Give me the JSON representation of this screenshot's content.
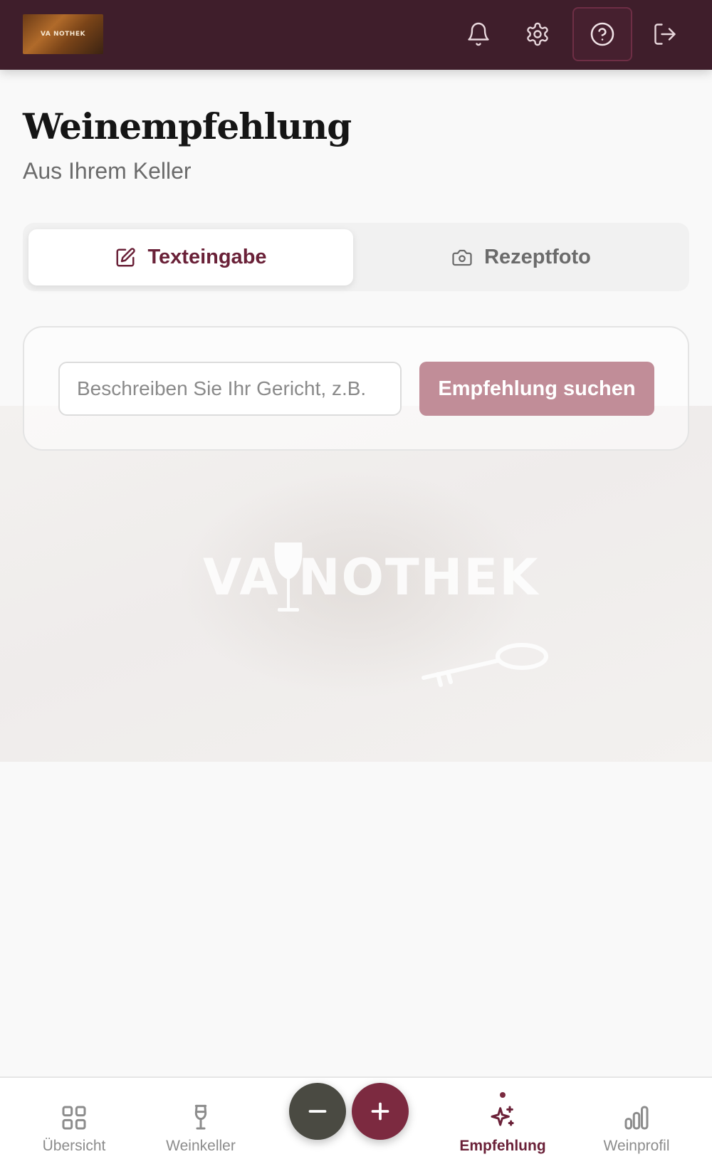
{
  "header": {
    "logo_text": "VA NOTHEK",
    "icons": [
      "bell-icon",
      "gear-icon",
      "help-circle-icon",
      "logout-icon"
    ],
    "active_icon": "help-circle-icon"
  },
  "page": {
    "title": "Weinempfehlung",
    "subtitle": "Aus Ihrem Keller"
  },
  "mode_tabs": [
    {
      "label": "Texteingabe",
      "icon": "edit-icon",
      "selected": true
    },
    {
      "label": "Rezeptfoto",
      "icon": "camera-icon",
      "selected": false
    }
  ],
  "search": {
    "placeholder": "Beschreiben Sie Ihr Gericht, z.B.",
    "value": "",
    "button_label": "Empfehlung suchen"
  },
  "watermark": {
    "text": "VA NOTHEK"
  },
  "bottom_nav": {
    "items": [
      {
        "label": "Übersicht",
        "icon": "grid-icon"
      },
      {
        "label": "Weinkeller",
        "icon": "wine-glass-icon"
      },
      {
        "label": "Empfehlung",
        "icon": "sparkles-icon",
        "active": true
      },
      {
        "label": "Weinprofil",
        "icon": "bar-chart-icon"
      }
    ],
    "fab_minus_icon": "minus-icon",
    "fab_plus_icon": "plus-icon"
  },
  "colors": {
    "header_bg": "#3f1e2b",
    "accent": "#6a2138",
    "button_bg": "#c18d98",
    "fab_minus": "#4a4a42",
    "fab_plus": "#7c2a40"
  }
}
